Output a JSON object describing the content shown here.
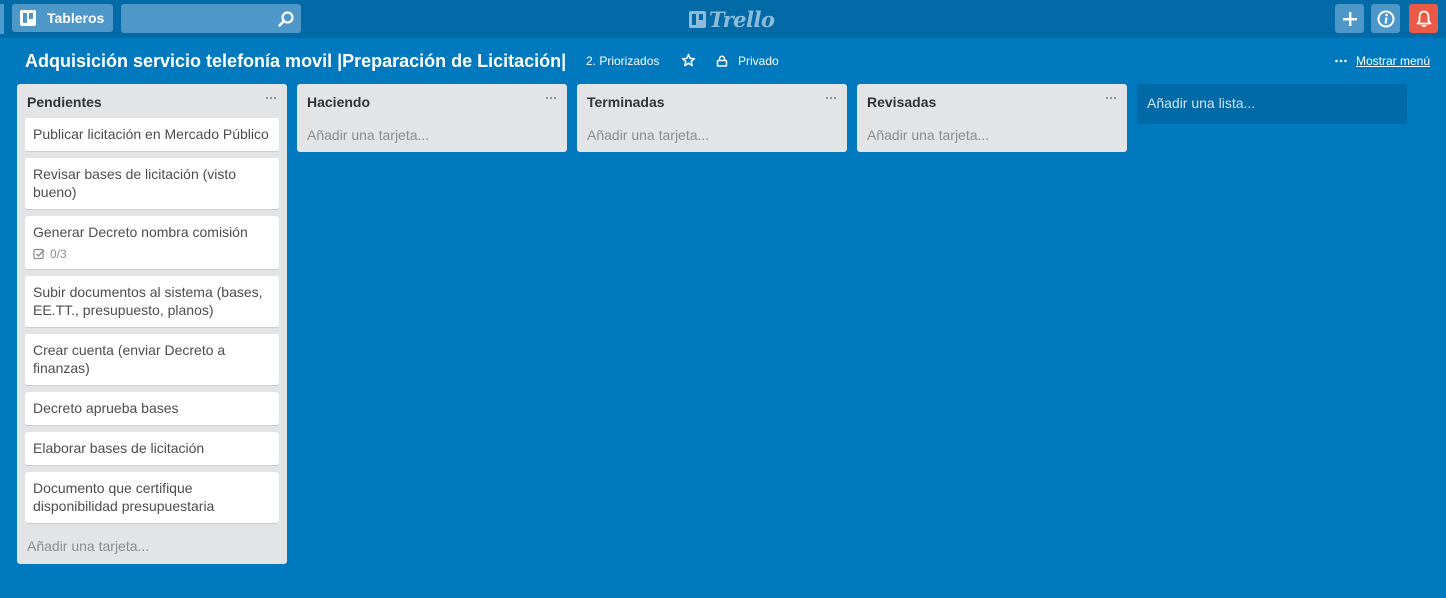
{
  "header": {
    "boards_label": "Tableros",
    "search": {
      "value": "",
      "placeholder": ""
    },
    "logo_text": "Trello"
  },
  "board": {
    "title": "Adquisición servicio telefonía movil |Preparación de Licitación|",
    "organization": "2. Priorizados",
    "visibility": "Privado",
    "menu_label": "Mostrar menú"
  },
  "lists": [
    {
      "title": "Pendientes",
      "cards": [
        {
          "title": "Publicar licitación en Mercado Público"
        },
        {
          "title": "Revisar bases de licitación (visto bueno)"
        },
        {
          "title": "Generar Decreto nombra comisión",
          "checklist": "0/3"
        },
        {
          "title": "Subir documentos al sistema (bases, EE.TT., presupuesto, planos)"
        },
        {
          "title": "Crear cuenta (enviar Decreto a finanzas)"
        },
        {
          "title": "Decreto aprueba bases"
        },
        {
          "title": "Elaborar bases de licitación"
        },
        {
          "title": "Documento que certifique disponibilidad presupuestaria"
        }
      ],
      "add_card_label": "Añadir una tarjeta..."
    },
    {
      "title": "Haciendo",
      "cards": [],
      "add_card_label": "Añadir una tarjeta..."
    },
    {
      "title": "Terminadas",
      "cards": [],
      "add_card_label": "Añadir una tarjeta..."
    },
    {
      "title": "Revisadas",
      "cards": [],
      "add_card_label": "Añadir una tarjeta..."
    }
  ],
  "add_list_label": "Añadir una lista...",
  "colors": {
    "board_background": "#0079bf",
    "header_background": "#026aa7",
    "list_background": "#e2e4e6",
    "notification_button": "#eb5a46"
  }
}
